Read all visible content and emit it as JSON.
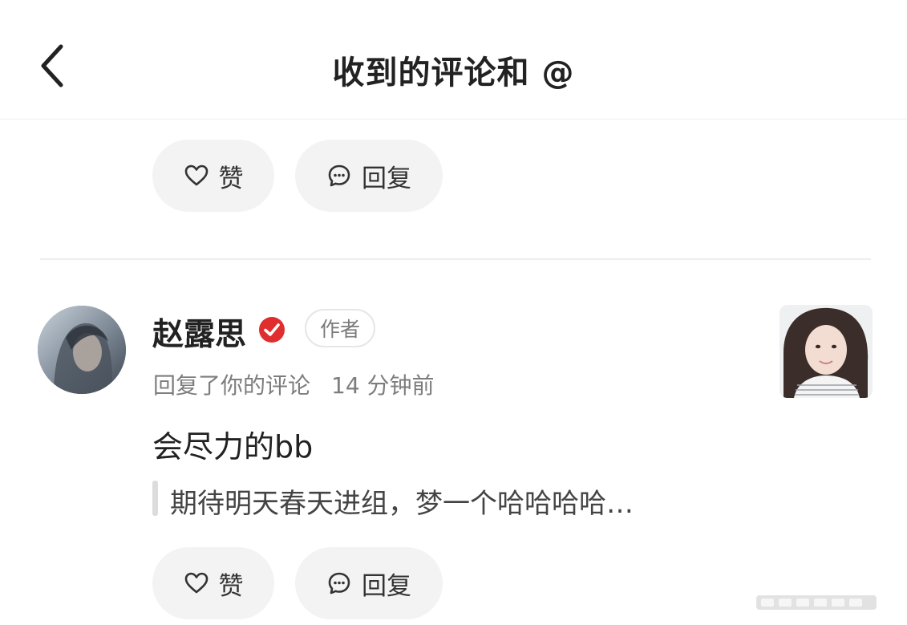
{
  "header": {
    "title": "收到的评论和 @",
    "back_icon": "chevron-left-icon"
  },
  "prev_item_actions": {
    "like_label": "赞",
    "reply_label": "回复"
  },
  "comment": {
    "username": "赵露思",
    "verified_icon": "verified-badge-icon",
    "author_badge": "作者",
    "action_text": "回复了你的评论",
    "time": "14 分钟前",
    "text": "会尽力的bb",
    "quoted_text": "期待明天春天进组，梦一个哈哈哈哈…",
    "like_label": "赞",
    "reply_label": "回复"
  },
  "colors": {
    "verified_red": "#e02e2e",
    "pill_bg": "#f3f3f3",
    "meta_gray": "#7d7d7d"
  }
}
